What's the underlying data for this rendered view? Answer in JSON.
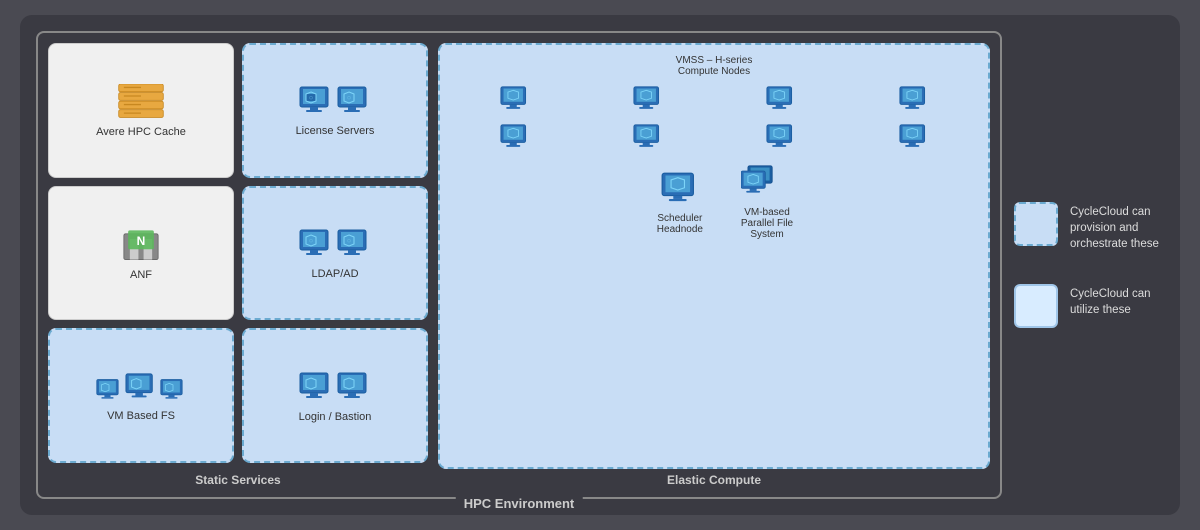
{
  "title": "HPC Environment",
  "diagram": {
    "hpc_label": "HPC Environment",
    "static_services_label": "Static Services",
    "elastic_compute_label": "Elastic Compute",
    "cards": {
      "avere": {
        "label": "Avere HPC Cache"
      },
      "license": {
        "label": "License Servers"
      },
      "anf": {
        "label": "ANF"
      },
      "ldap": {
        "label": "LDAP/AD"
      },
      "vm_fs": {
        "label": "VM Based FS"
      },
      "login_bastion": {
        "label": "Login / Bastion"
      }
    },
    "elastic": {
      "vmss_label": "VMSS – H-series\nCompute Nodes",
      "scheduler_label": "Scheduler Headnode",
      "vm_parallel_label": "VM-based\nParallel File\nSystem"
    }
  },
  "legend": {
    "item1": {
      "label": "CycleCloud can provision and orchestrate these"
    },
    "item2": {
      "label": "CycleCloud can utilize these"
    }
  }
}
